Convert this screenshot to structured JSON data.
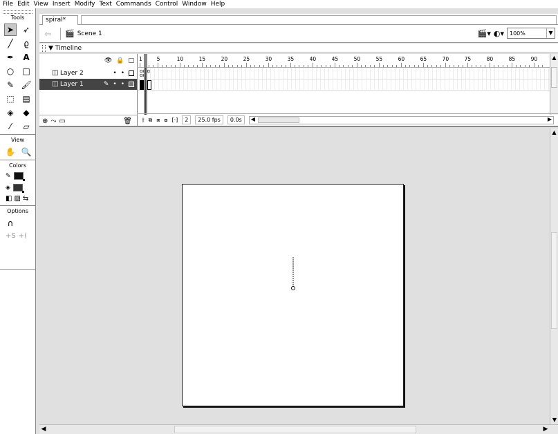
{
  "menu": [
    "File",
    "Edit",
    "View",
    "Insert",
    "Modify",
    "Text",
    "Commands",
    "Control",
    "Window",
    "Help"
  ],
  "tools": {
    "title": "Tools",
    "view_title": "View",
    "colors_title": "Colors",
    "options_title": "Options",
    "items": [
      "arrow-tool",
      "subselect-tool",
      "line-tool",
      "lasso-tool",
      "pen-tool",
      "text-tool",
      "oval-tool",
      "rectangle-tool",
      "pencil-tool",
      "brush-tool",
      "free-transform-tool",
      "fill-transform-tool",
      "ink-bottle-tool",
      "paint-bucket-tool",
      "eyedropper-tool",
      "eraser-tool"
    ]
  },
  "document": {
    "tab": "spiral*",
    "scene": "Scene 1",
    "zoom": "100%"
  },
  "timeline": {
    "title": "Timeline",
    "ruler": [
      "1",
      "5",
      "10",
      "15",
      "20",
      "25",
      "30",
      "35",
      "40",
      "45",
      "50",
      "55",
      "60",
      "65",
      "70",
      "75",
      "80",
      "85",
      "90"
    ],
    "layers": [
      {
        "name": "Layer 2",
        "active": false
      },
      {
        "name": "Layer 1",
        "active": true
      }
    ],
    "current_frame": "2",
    "fps": "25.0 fps",
    "elapsed": "0.0s"
  }
}
